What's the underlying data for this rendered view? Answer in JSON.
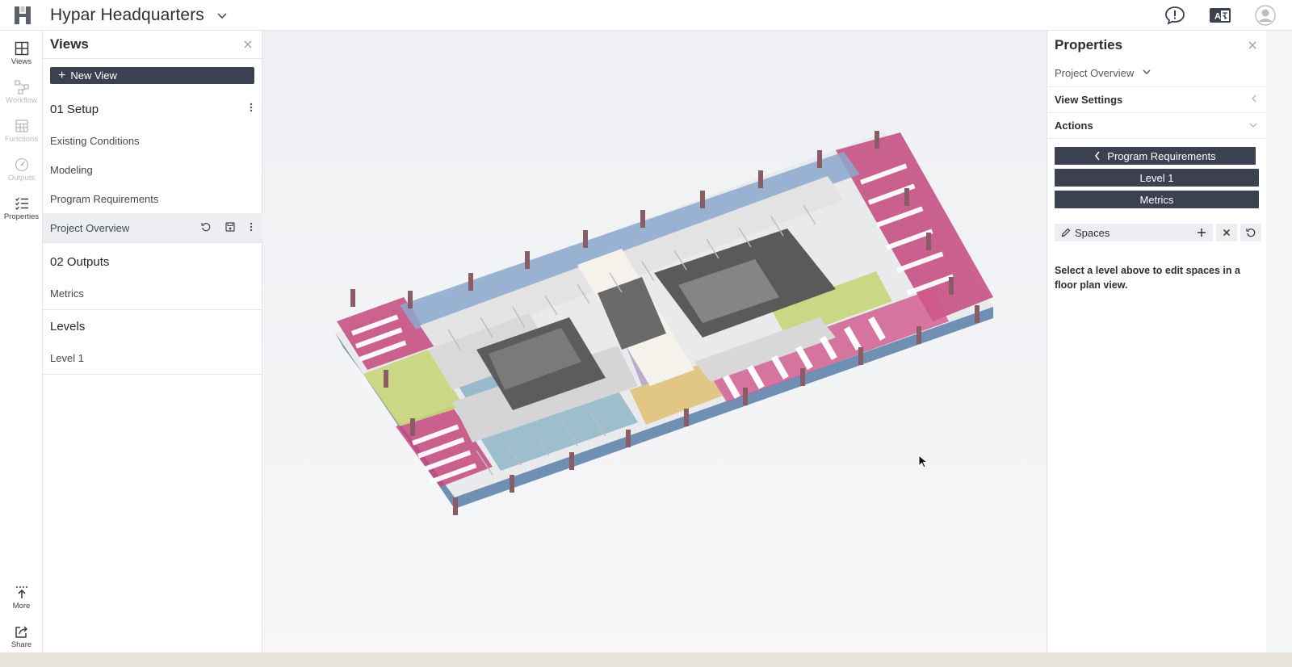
{
  "app": {
    "project_title": "Hypar Headquarters"
  },
  "rail": {
    "items": [
      {
        "label": "Views"
      },
      {
        "label": "Workflow"
      },
      {
        "label": "Functions"
      },
      {
        "label": "Outputs"
      },
      {
        "label": "Properties"
      }
    ],
    "bottom": [
      {
        "label": "More"
      },
      {
        "label": "Share"
      }
    ]
  },
  "views_panel": {
    "title": "Views",
    "new_view_label": "New View",
    "groups": [
      {
        "title": "01 Setup",
        "items": [
          "Existing Conditions",
          "Modeling",
          "Program Requirements",
          "Project Overview"
        ]
      },
      {
        "title": "02 Outputs",
        "items": [
          "Metrics"
        ]
      },
      {
        "title": "Levels",
        "items": [
          "Level 1"
        ]
      }
    ]
  },
  "properties_panel": {
    "title": "Properties",
    "selected_view": "Project Overview",
    "view_settings_label": "View Settings",
    "actions_label": "Actions",
    "buttons": {
      "program_requirements": "Program Requirements",
      "level_1": "Level 1",
      "metrics": "Metrics"
    },
    "spaces_label": "Spaces",
    "hint": "Select a level above to edit spaces in a floor plan view."
  },
  "colors": {
    "accent_button": "#3b4150",
    "zone_pink": "#c4487e",
    "zone_blue": "#7fa4c9",
    "zone_green": "#c6d67a",
    "zone_yellow": "#e0c27a",
    "wall_grey": "#dcdcdc",
    "core_dark": "#555555"
  }
}
